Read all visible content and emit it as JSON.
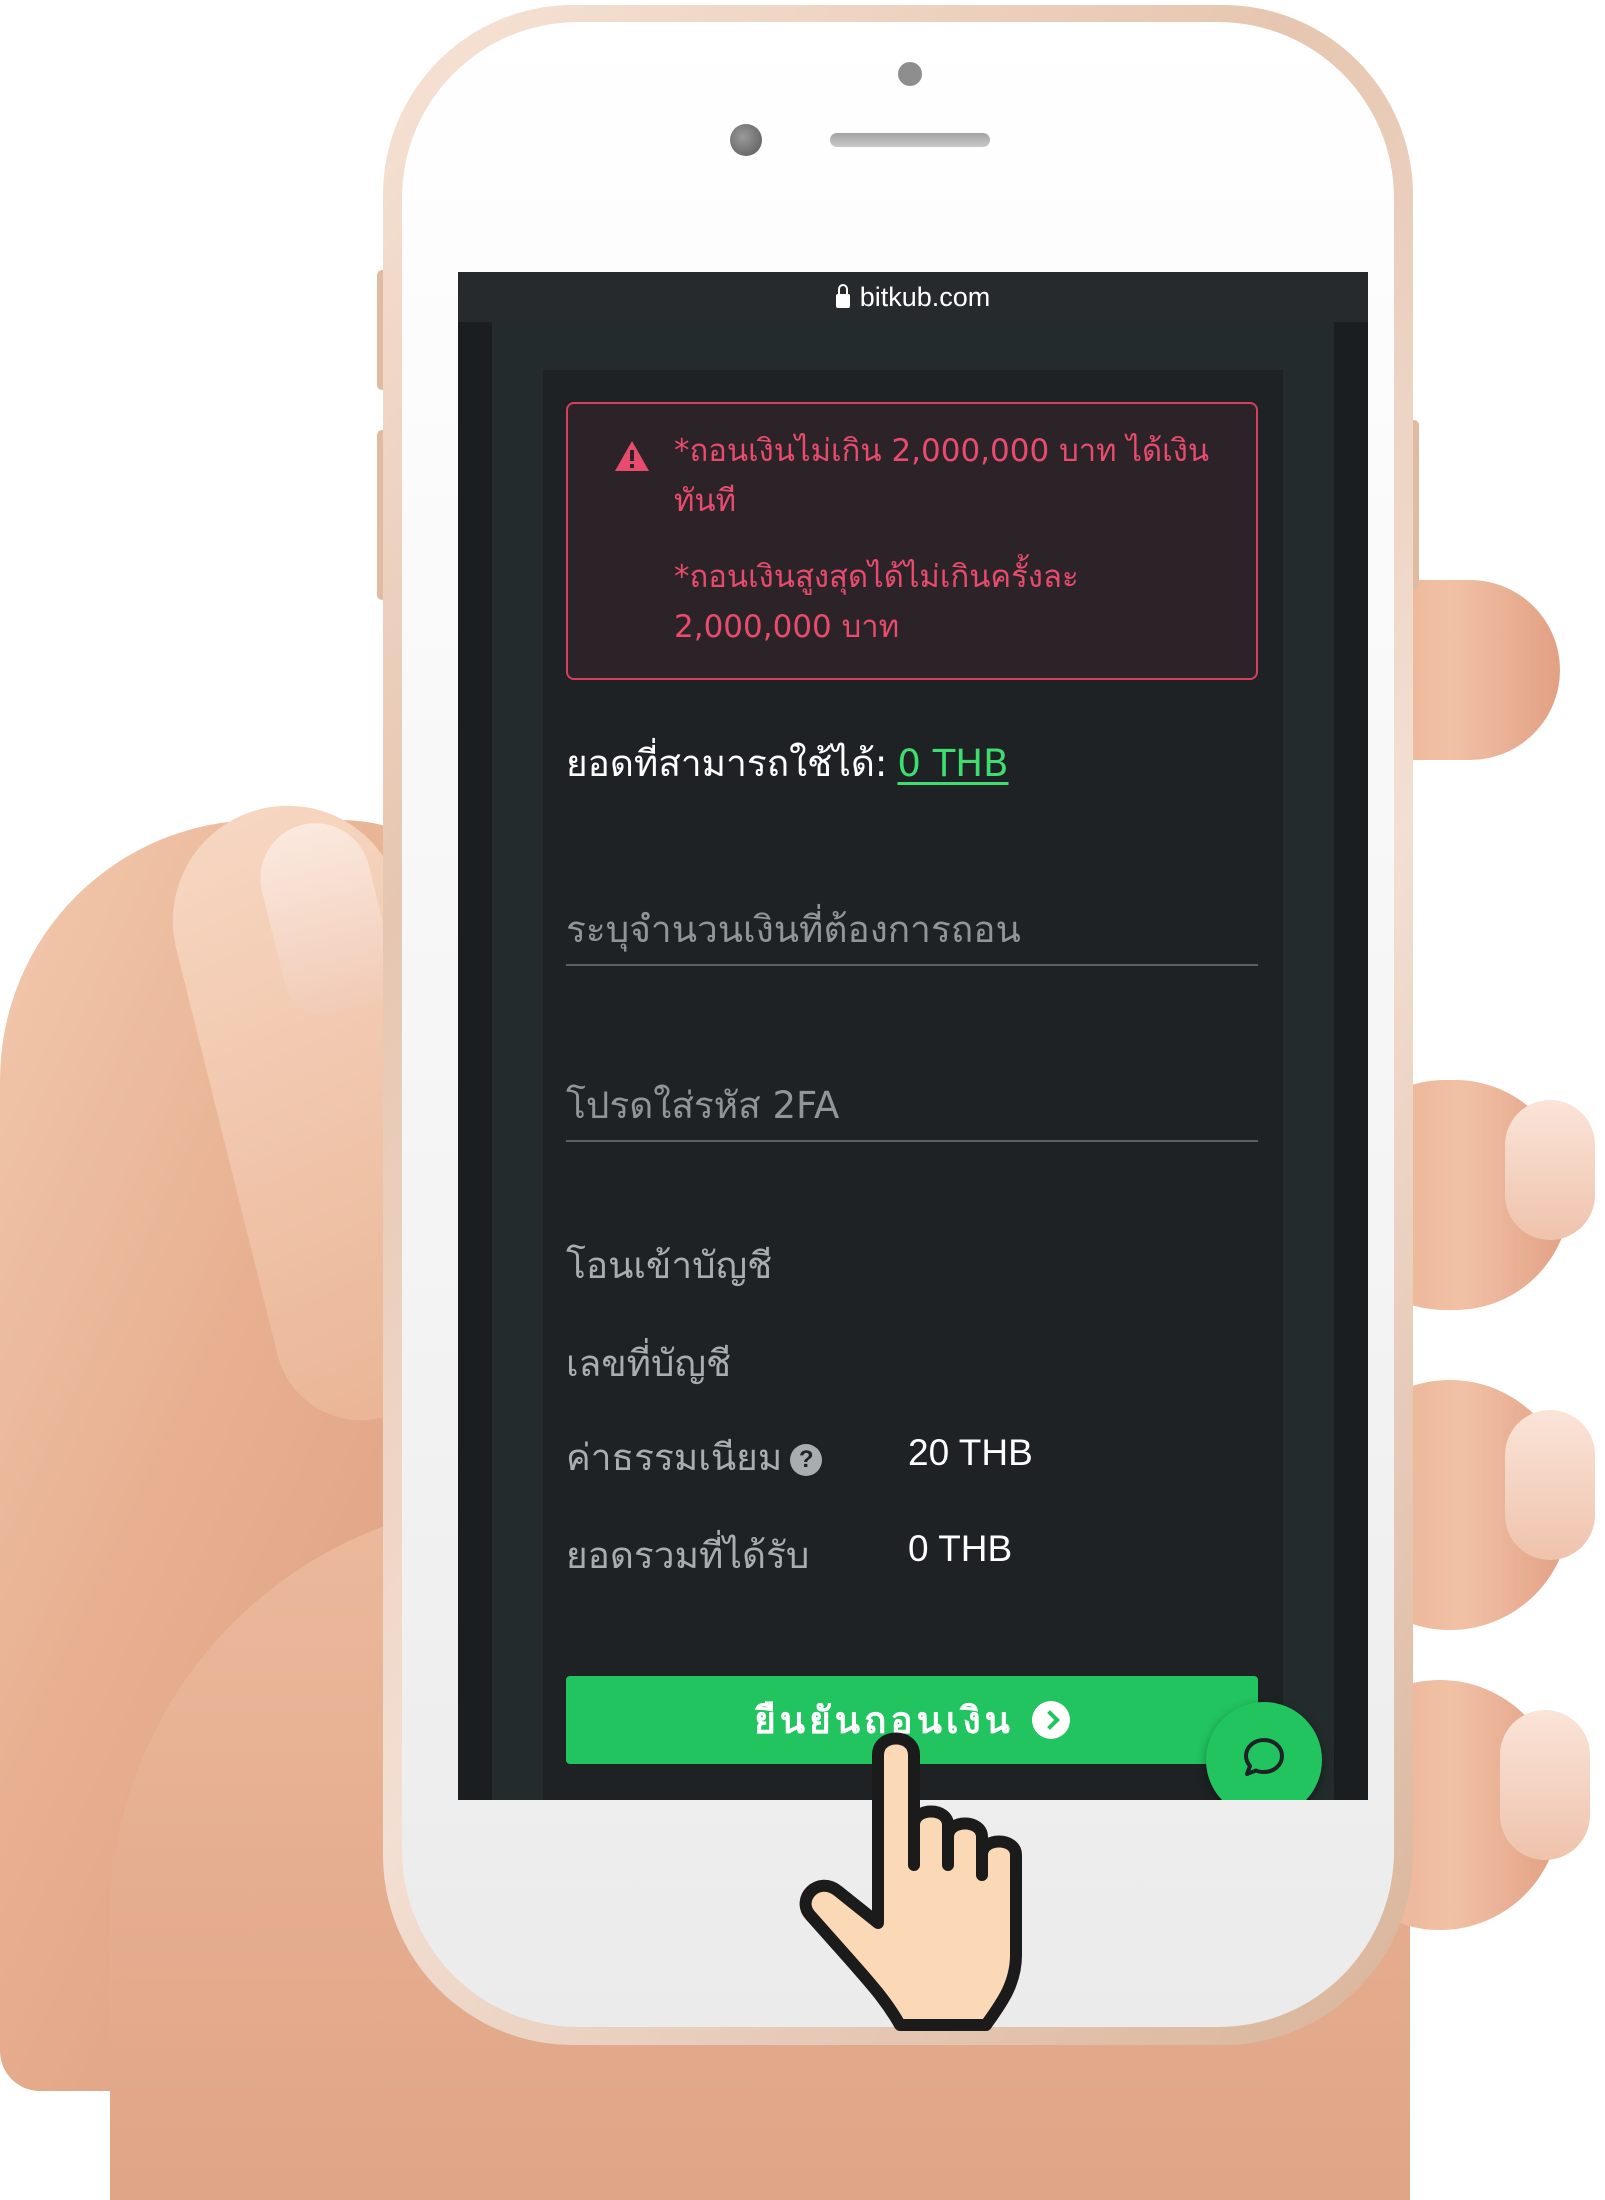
{
  "browser": {
    "url": "bitkub.com"
  },
  "alert": {
    "line1": "*ถอนเงินไม่เกิน 2,000,000 บาท ได้เงินทันที",
    "line2": "*ถอนเงินสูงสุดได้ไม่เกินครั้งละ 2,000,000 บาท",
    "color": "#e74b6e"
  },
  "balance": {
    "label": "ยอดที่สามารถใช้ได้:",
    "value": "0 THB"
  },
  "form": {
    "amount_placeholder": "ระบุจำนวนเงินที่ต้องการถอน",
    "twofa_placeholder": "โปรดใส่รหัส 2FA"
  },
  "details": {
    "bank_label": "โอนเข้าบัญชี",
    "account_label": "เลขที่บัญชี",
    "fee_label": "ค่าธรรมเนียม",
    "fee_value": "20 THB",
    "total_label": "ยอดรวมที่ได้รับ",
    "total_value": "0 THB",
    "help_icon": "?"
  },
  "actions": {
    "confirm_label": "ยืนยันถอนเงิน",
    "accent_color": "#22c45f"
  },
  "icons": {
    "lock": "lock-icon",
    "alert": "warning-triangle-icon",
    "help": "question-circle-icon",
    "confirm_arrow": "chevron-right-circle-icon",
    "chat": "chat-bubble-icon",
    "pointer": "pointing-hand-icon"
  }
}
